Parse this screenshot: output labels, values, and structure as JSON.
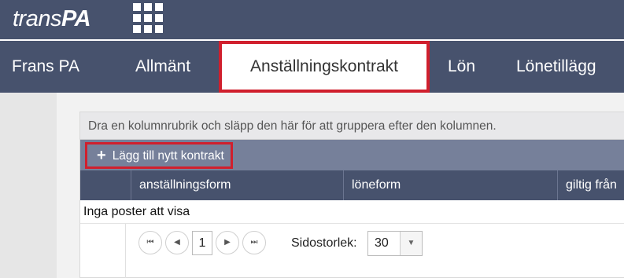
{
  "app": {
    "logo_part1": "trans",
    "logo_part2": "PA",
    "apps_icon": "grid-icon"
  },
  "nav": {
    "items": [
      {
        "label": "Frans PA"
      },
      {
        "label": "Allmänt"
      },
      {
        "label": "Anställningskontrakt",
        "active": true
      },
      {
        "label": "Lön"
      },
      {
        "label": "Lönetillägg"
      }
    ]
  },
  "grid": {
    "group_hint": "Dra en kolumnrubrik och släpp den här för att gruppera efter den kolumnen.",
    "add_button": "Lägg till nytt kontrakt",
    "add_icon": "plus-icon",
    "columns": [
      "anställningsform",
      "löneform",
      "giltig från"
    ],
    "empty_text": "Inga poster att visa"
  },
  "pager": {
    "current_page": "1",
    "page_size_label": "Sidostorlek:",
    "page_size": "30",
    "first_icon": "first-page-icon",
    "prev_icon": "prev-page-icon",
    "next_icon": "next-page-icon",
    "last_icon": "last-page-icon"
  },
  "colors": {
    "header_bg": "#47526d",
    "toolbar_bg": "#76809a",
    "highlight": "#d01f2d"
  }
}
